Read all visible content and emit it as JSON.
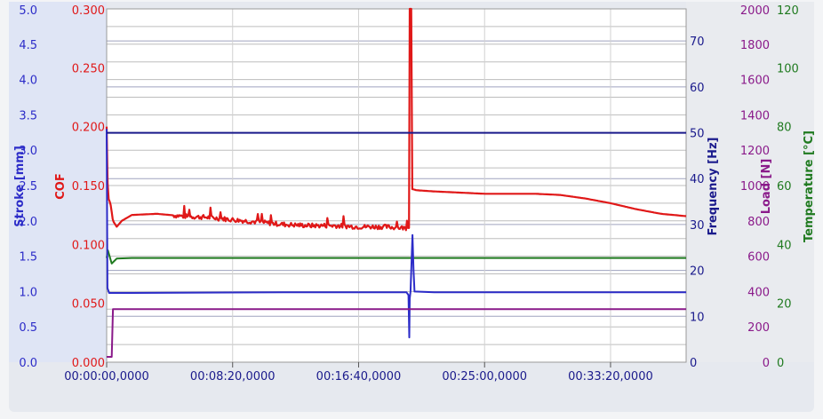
{
  "chart_data": {
    "type": "line",
    "x_axis": {
      "ticks": [
        "00:00:00,0000",
        "00:08:20,0000",
        "00:16:40,0000",
        "00:25:00,0000",
        "00:33:20,0000"
      ],
      "tick_seconds": [
        0,
        500,
        1000,
        1500,
        2000
      ],
      "range_seconds": [
        0,
        2300
      ]
    },
    "axes": [
      {
        "id": "stroke",
        "label": "Stroke [mm]",
        "color": "#2c2cc8",
        "range": [
          0,
          5
        ],
        "ticks": [
          "0.0",
          "0.5",
          "1.0",
          "1.5",
          "2.0",
          "2.5",
          "3.0",
          "3.5",
          "4.0",
          "4.5",
          "5.0"
        ]
      },
      {
        "id": "cof",
        "label": "COF",
        "color": "#e01818",
        "range": [
          0,
          0.3
        ],
        "ticks": [
          "0.000",
          "0.050",
          "0.100",
          "0.150",
          "0.200",
          "0.250",
          "0.300"
        ]
      },
      {
        "id": "frequency",
        "label": "Frequency [Hz]",
        "color": "#1a1a8c",
        "range": [
          0,
          77
        ],
        "ticks": [
          "0",
          "10",
          "20",
          "30",
          "40",
          "50",
          "60",
          "70"
        ]
      },
      {
        "id": "load",
        "label": "Load [N]",
        "color": "#8a1a8a",
        "range": [
          0,
          2000
        ],
        "ticks": [
          "0",
          "200",
          "400",
          "600",
          "800",
          "1000",
          "1200",
          "1400",
          "1600",
          "1800",
          "2000"
        ]
      },
      {
        "id": "temperature",
        "label": "Temperature [°C]",
        "color": "#1f7a1f",
        "range": [
          0,
          120
        ],
        "ticks": [
          "0",
          "20",
          "40",
          "60",
          "80",
          "100",
          "120"
        ]
      }
    ],
    "grid": true,
    "series": [
      {
        "axis": "cof",
        "color": "#e01818",
        "noisy": true,
        "points": [
          [
            0,
            0.2
          ],
          [
            5,
            0.14
          ],
          [
            15,
            0.135
          ],
          [
            25,
            0.12
          ],
          [
            40,
            0.115
          ],
          [
            60,
            0.12
          ],
          [
            100,
            0.125
          ],
          [
            200,
            0.126
          ],
          [
            300,
            0.124
          ],
          [
            400,
            0.123
          ],
          [
            500,
            0.121
          ],
          [
            600,
            0.119
          ],
          [
            700,
            0.117
          ],
          [
            800,
            0.116
          ],
          [
            900,
            0.116
          ],
          [
            1000,
            0.115
          ],
          [
            1100,
            0.115
          ],
          [
            1180,
            0.114
          ],
          [
            1200,
            0.114
          ],
          [
            1203,
            0.3
          ],
          [
            1209,
            0.3
          ],
          [
            1213,
            0.147
          ],
          [
            1230,
            0.146
          ],
          [
            1300,
            0.145
          ],
          [
            1400,
            0.144
          ],
          [
            1500,
            0.143
          ],
          [
            1600,
            0.143
          ],
          [
            1700,
            0.143
          ],
          [
            1800,
            0.142
          ],
          [
            1900,
            0.139
          ],
          [
            2000,
            0.135
          ],
          [
            2100,
            0.13
          ],
          [
            2200,
            0.126
          ],
          [
            2300,
            0.124
          ]
        ]
      },
      {
        "axis": "temperature",
        "color": "#1f7a1f",
        "points": [
          [
            0,
            35.4
          ],
          [
            5,
            38
          ],
          [
            20,
            33.5
          ],
          [
            40,
            35.2
          ],
          [
            100,
            35.4
          ],
          [
            2300,
            35.4
          ]
        ]
      },
      {
        "axis": "stroke",
        "color": "#2c2cc8",
        "points": [
          [
            0,
            3.3
          ],
          [
            3,
            1.05
          ],
          [
            10,
            0.98
          ],
          [
            100,
            0.98
          ],
          [
            700,
            0.99
          ],
          [
            1190,
            0.99
          ],
          [
            1198,
            0.95
          ],
          [
            1201,
            0.35
          ],
          [
            1203,
            0.9
          ],
          [
            1206,
            1.0
          ],
          [
            1210,
            1.4
          ],
          [
            1214,
            1.8
          ],
          [
            1218,
            1.3
          ],
          [
            1222,
            1.0
          ],
          [
            1300,
            0.99
          ],
          [
            2300,
            0.99
          ]
        ]
      },
      {
        "axis": "frequency",
        "color": "#1a1a8c",
        "points": [
          [
            0,
            50
          ],
          [
            2300,
            50
          ]
        ]
      },
      {
        "axis": "load",
        "color": "#8a1a8a",
        "points": [
          [
            0,
            30
          ],
          [
            20,
            30
          ],
          [
            25,
            300
          ],
          [
            2300,
            300
          ]
        ]
      }
    ]
  }
}
